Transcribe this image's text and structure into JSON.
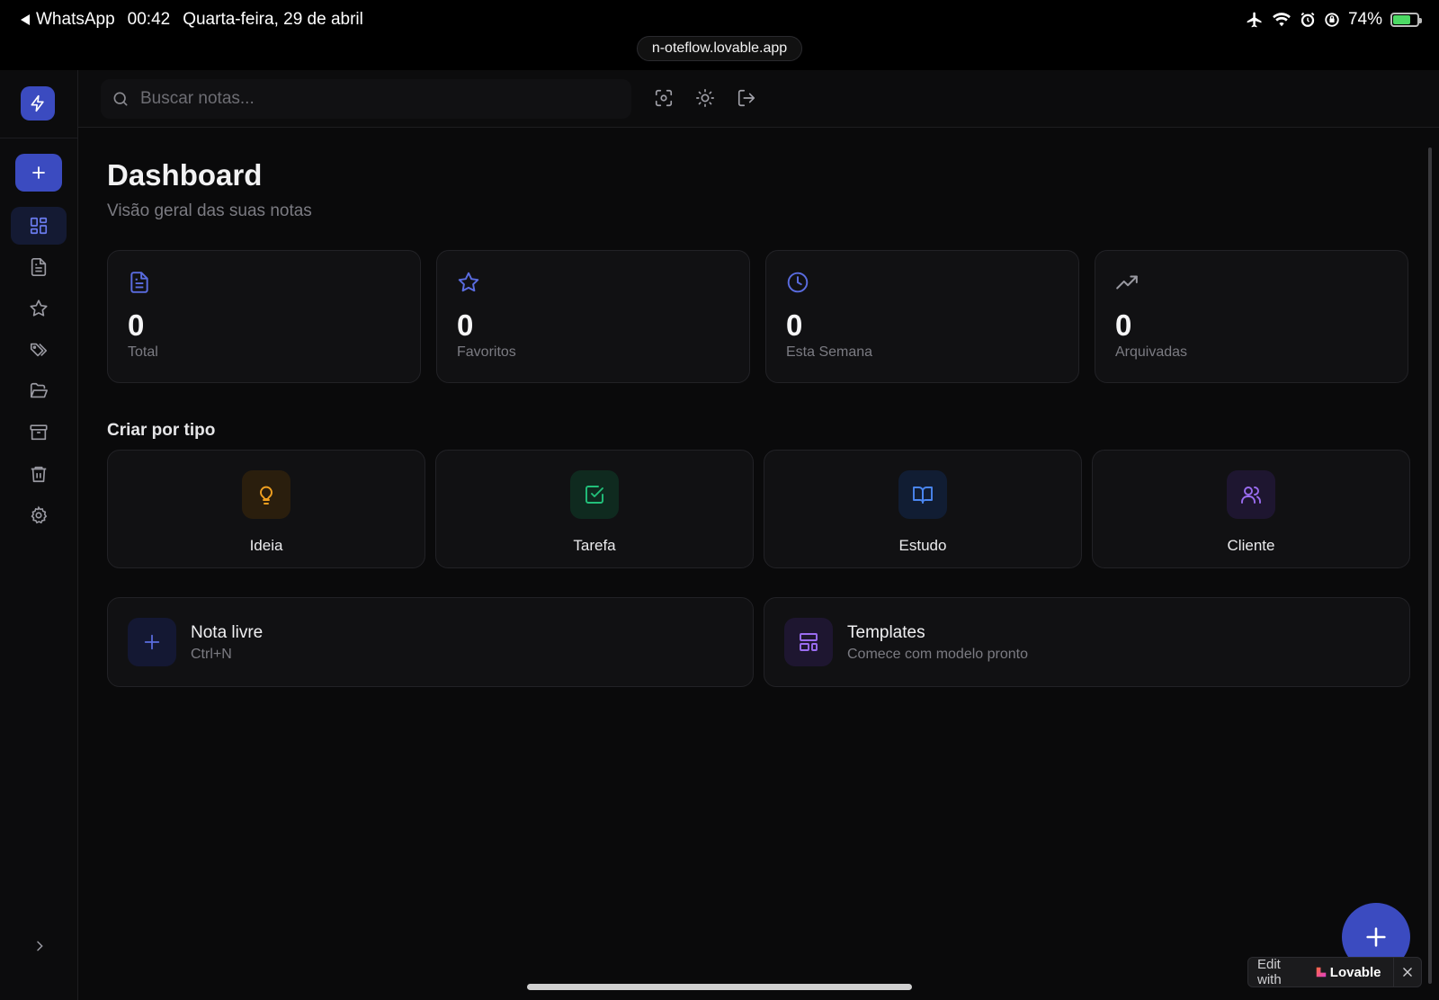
{
  "status_bar": {
    "back_app": "WhatsApp",
    "time": "00:42",
    "date": "Quarta-feira, 29 de abril",
    "battery": "74%"
  },
  "browser": {
    "url": "n-oteflow.lovable.app"
  },
  "search": {
    "placeholder": "Buscar notas..."
  },
  "sidebar": {
    "items": [
      {
        "icon": "grid-icon",
        "active": true
      },
      {
        "icon": "file-text-icon"
      },
      {
        "icon": "star-icon"
      },
      {
        "icon": "tags-icon"
      },
      {
        "icon": "folder-open-icon"
      },
      {
        "icon": "archive-icon"
      },
      {
        "icon": "trash-icon"
      },
      {
        "icon": "settings-icon"
      }
    ]
  },
  "header": {
    "title": "Dashboard",
    "subtitle": "Visão geral das suas notas"
  },
  "stats": [
    {
      "value": "0",
      "label": "Total",
      "icon": "file-text-icon"
    },
    {
      "value": "0",
      "label": "Favoritos",
      "icon": "star-icon"
    },
    {
      "value": "0",
      "label": "Esta Semana",
      "icon": "clock-icon"
    },
    {
      "value": "0",
      "label": "Arquivadas",
      "icon": "trending-up-icon"
    }
  ],
  "create_section": {
    "title": "Criar por tipo",
    "types": [
      {
        "label": "Ideia",
        "icon": "lightbulb-icon",
        "color": "#f0a020"
      },
      {
        "label": "Tarefa",
        "icon": "check-square-icon",
        "color": "#22c07a"
      },
      {
        "label": "Estudo",
        "icon": "book-open-icon",
        "color": "#4a86f0"
      },
      {
        "label": "Cliente",
        "icon": "users-icon",
        "color": "#9a6cf0"
      }
    ]
  },
  "quick_actions": [
    {
      "title": "Nota livre",
      "subtitle": "Ctrl+N",
      "icon": "plus-icon"
    },
    {
      "title": "Templates",
      "subtitle": "Comece com modelo pronto",
      "icon": "layout-template-icon"
    }
  ],
  "lovable_badge": {
    "prefix": "Edit with",
    "brand": "Lovable"
  },
  "colors": {
    "accent": "#3b4bc0",
    "background": "#0a0a0b",
    "card": "#111113"
  }
}
